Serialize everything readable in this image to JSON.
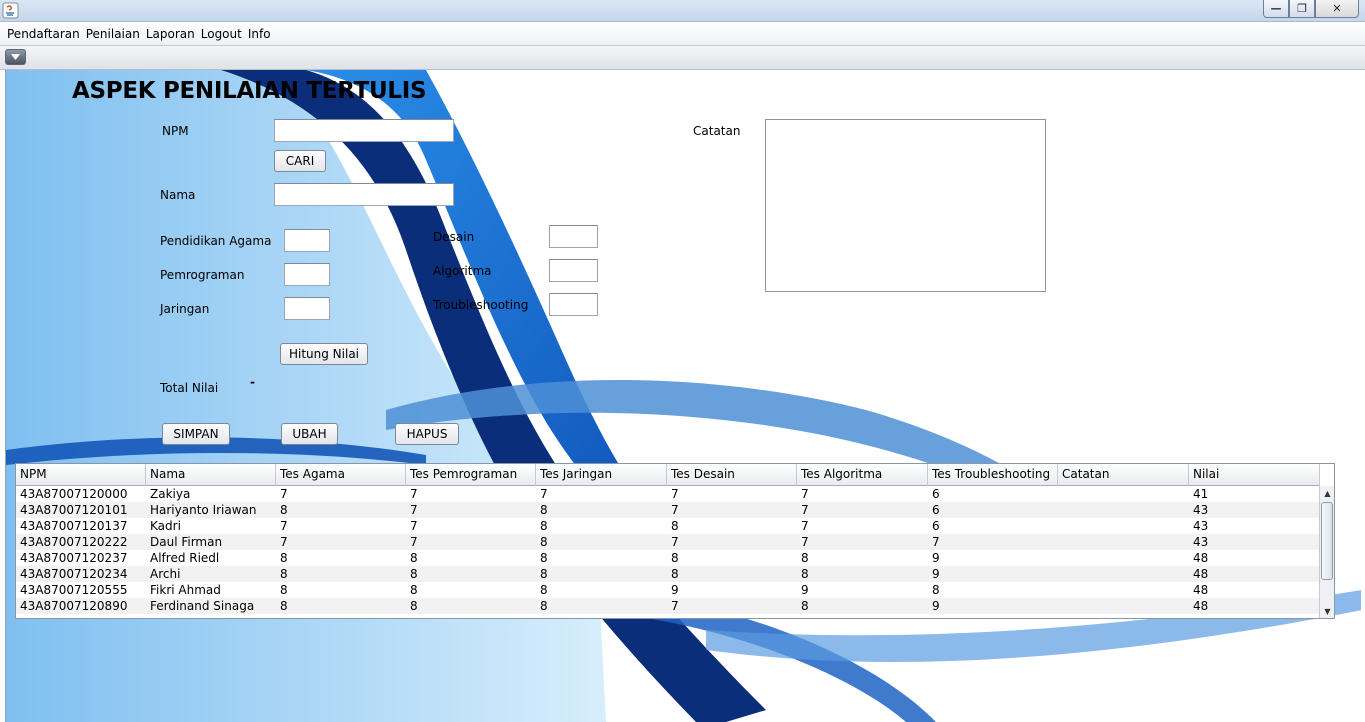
{
  "window": {
    "controls": [
      "minimize-icon",
      "maximize-icon",
      "close-icon"
    ]
  },
  "menubar": {
    "items": [
      "Pendaftaran",
      "Penilaian",
      "Laporan",
      "Logout",
      "Info"
    ]
  },
  "form": {
    "title": "ASPEK PENILAIAN TERTULIS",
    "npm_label": "NPM",
    "npm_value": "",
    "cari_label": "CARI",
    "nama_label": "Nama",
    "nama_value": "",
    "agama_label": "Pendidikan Agama",
    "pemrograman_label": "Pemrograman",
    "jaringan_label": "Jaringan",
    "desain_label": "Desain",
    "algoritma_label": "Algoritma",
    "troubleshooting_label": "Troubleshooting",
    "catatan_label": "Catatan",
    "hitung_label": "Hitung Nilai",
    "total_label": "Total Nilai",
    "total_value": "-",
    "simpan_label": "SIMPAN",
    "ubah_label": "UBAH",
    "hapus_label": "HAPUS"
  },
  "table": {
    "columns": [
      "NPM",
      "Nama",
      "Tes Agama",
      "Tes Pemrograman",
      "Tes Jaringan",
      "Tes Desain",
      "Tes Algoritma",
      "Tes Troubleshooting",
      "Catatan",
      "Nilai"
    ],
    "rows": [
      [
        "43A87007120000",
        "Zakiya",
        "7",
        "7",
        "7",
        "7",
        "7",
        "6",
        "",
        "41"
      ],
      [
        "43A87007120101",
        "Hariyanto Iriawan",
        "8",
        "7",
        "8",
        "7",
        "7",
        "6",
        "",
        "43"
      ],
      [
        "43A87007120137",
        "Kadri",
        "7",
        "7",
        "8",
        "8",
        "7",
        "6",
        "",
        "43"
      ],
      [
        "43A87007120222",
        "Daul Firman",
        "7",
        "7",
        "8",
        "7",
        "7",
        "7",
        "",
        "43"
      ],
      [
        "43A87007120237",
        "Alfred Riedl",
        "8",
        "8",
        "8",
        "8",
        "8",
        "9",
        "",
        "48"
      ],
      [
        "43A87007120234",
        "Archi",
        "8",
        "8",
        "8",
        "8",
        "8",
        "9",
        "",
        "48"
      ],
      [
        "43A87007120555",
        "Fikri Ahmad",
        "8",
        "8",
        "8",
        "9",
        "9",
        "8",
        "",
        "48"
      ],
      [
        "43A87007120890",
        "Ferdinand Sinaga",
        "8",
        "8",
        "8",
        "7",
        "8",
        "9",
        "",
        "48"
      ]
    ]
  },
  "colors": {
    "dark_blue": "#0a2a73",
    "mid_blue": "#1e6fd0",
    "light_blue": "#9fd2f7"
  }
}
